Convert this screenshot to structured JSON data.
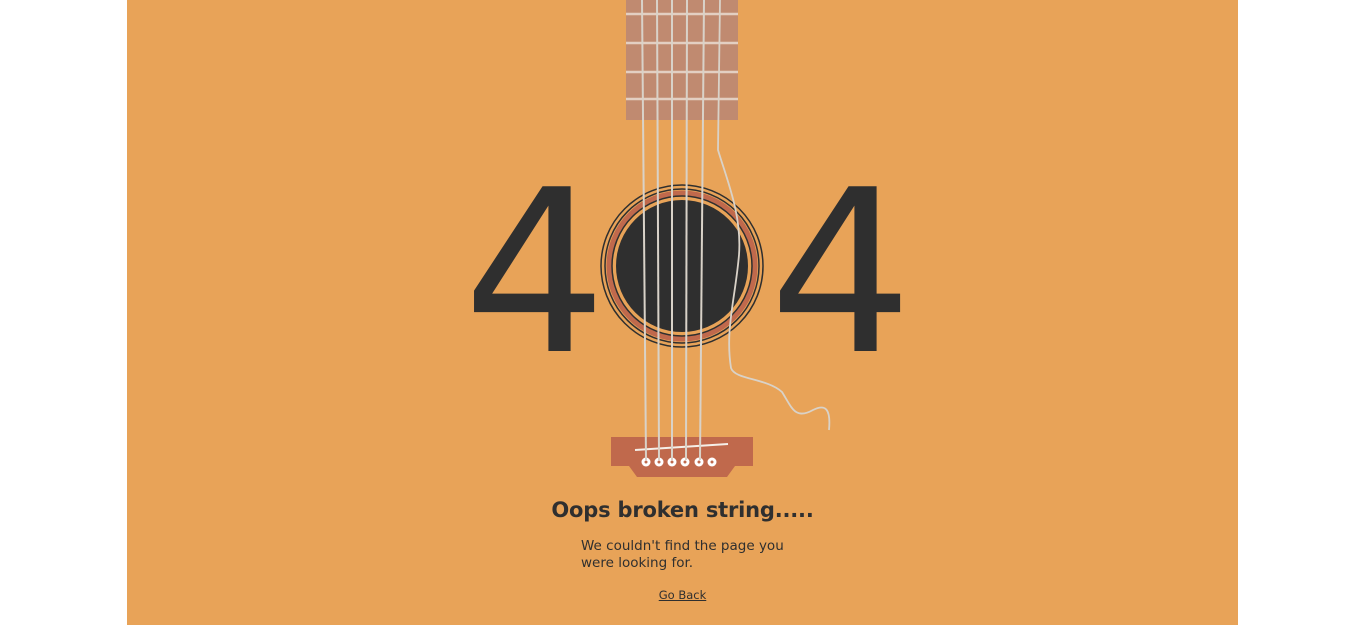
{
  "error": {
    "digit_left": "4",
    "digit_right": "4",
    "headline": "Oops broken string.....",
    "message": "We couldn't find the page you were looking for.",
    "go_back_label": "Go Back"
  },
  "colors": {
    "background": "#e8a358",
    "text": "#2f2f2f",
    "fretboard": "#c08a70",
    "bridge": "#c0694c",
    "string": "#d9d2c8"
  },
  "icons": {
    "guitar": "guitar-illustration",
    "soundhole": "soundhole-icon"
  }
}
